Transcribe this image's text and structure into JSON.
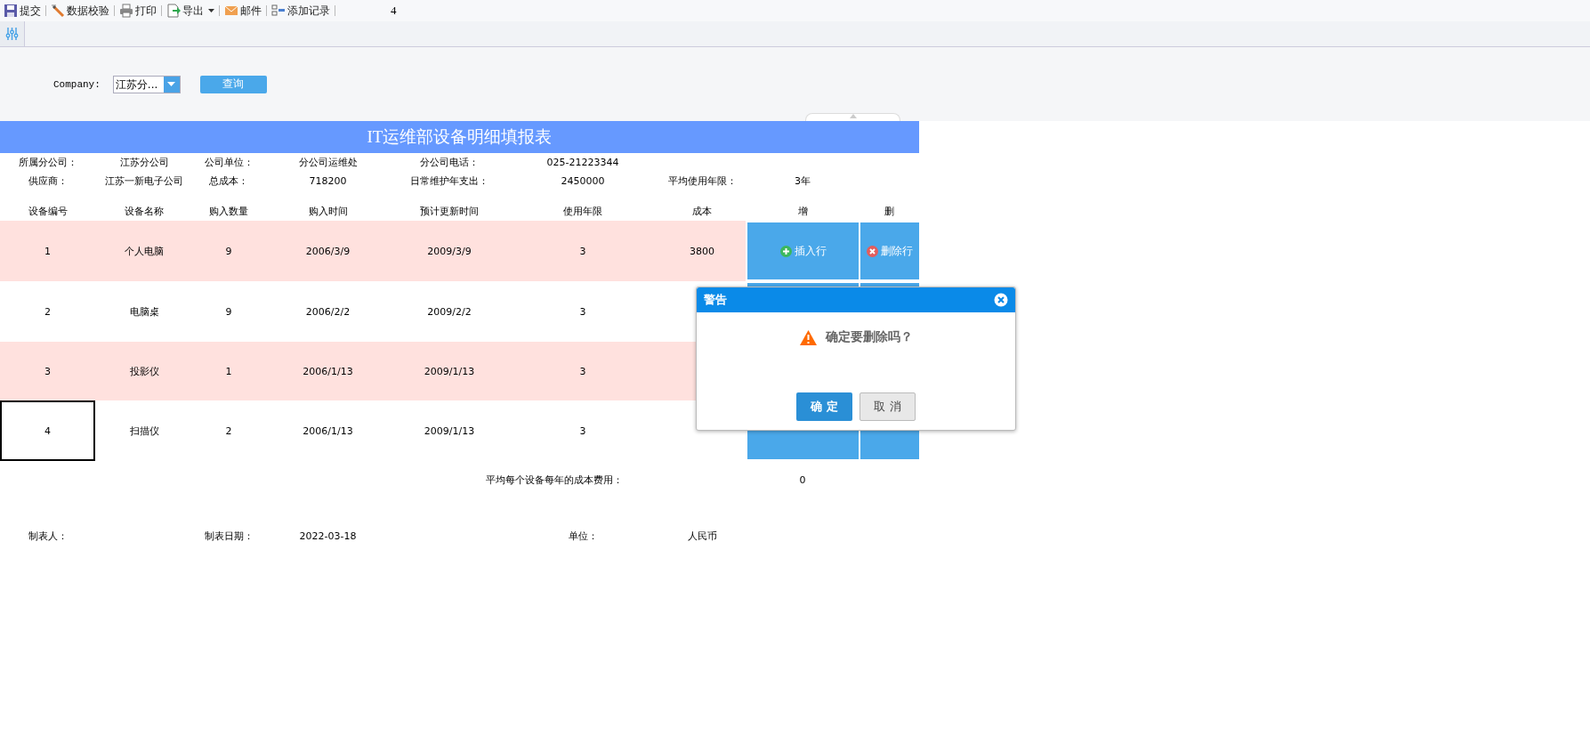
{
  "toolbar": {
    "items": [
      {
        "kind": "save",
        "label": "提交",
        "has_menu": false
      },
      {
        "kind": "check",
        "label": "数据校验",
        "has_menu": false
      },
      {
        "kind": "print",
        "label": "打印",
        "has_menu": false
      },
      {
        "kind": "export",
        "label": "导出",
        "has_menu": true
      },
      {
        "kind": "mail",
        "label": "邮件",
        "has_menu": false
      },
      {
        "kind": "add",
        "label": "添加记录",
        "has_menu": false
      }
    ],
    "page_number": "4"
  },
  "filter": {
    "label": "Company:",
    "select_value": "江苏分...",
    "button": "查询"
  },
  "report": {
    "title": "IT运维部设备明细填报表",
    "info_rows": [
      [
        {
          "label": "所属分公司：",
          "value": "江苏分公司"
        },
        {
          "label": "公司单位：",
          "value": "分公司运维处"
        },
        {
          "label": "分公司电话：",
          "value": "025-21223344"
        }
      ],
      [
        {
          "label": "供应商：",
          "value": "江苏一新电子公司"
        },
        {
          "label": "总成本：",
          "value": "718200"
        },
        {
          "label": "日常维护年支出：",
          "value": "2450000"
        },
        {
          "label": "平均使用年限：",
          "value": "3年"
        }
      ]
    ],
    "columns": [
      "设备编号",
      "设备名称",
      "购入数量",
      "购入时间",
      "预计更新时间",
      "使用年限",
      "成本",
      "增",
      "删"
    ],
    "rows": [
      {
        "highlighted": true,
        "selected": false,
        "cells": [
          "1",
          "个人电脑",
          "9",
          "2006/3/9",
          "2009/3/9",
          "3",
          "3800"
        ],
        "has_actions": true,
        "insert": "插入行",
        "delete": "删除行"
      },
      {
        "highlighted": false,
        "selected": false,
        "cells": [
          "2",
          "电脑桌",
          "9",
          "2006/2/2",
          "2009/2/2",
          "3"
        ],
        "has_actions": true
      },
      {
        "highlighted": true,
        "selected": false,
        "cells": [
          "3",
          "投影仪",
          "1",
          "2006/1/13",
          "2009/1/13",
          "3"
        ],
        "has_actions": false
      },
      {
        "highlighted": false,
        "selected": true,
        "cells": [
          "4",
          "扫描仪",
          "2",
          "2006/1/13",
          "2009/1/13",
          "3"
        ],
        "has_actions": true
      }
    ],
    "summary": {
      "label": "平均每个设备每年的成本费用：",
      "value": "0"
    },
    "footer": [
      {
        "label": "制表人："
      },
      {
        "label": "制表日期：",
        "value": "2022-03-18"
      },
      {
        "label": "单位：",
        "value": "人民币"
      }
    ]
  },
  "dialog": {
    "title": "警告",
    "message": "确定要删除吗？",
    "ok": "确 定",
    "cancel": "取 消"
  }
}
